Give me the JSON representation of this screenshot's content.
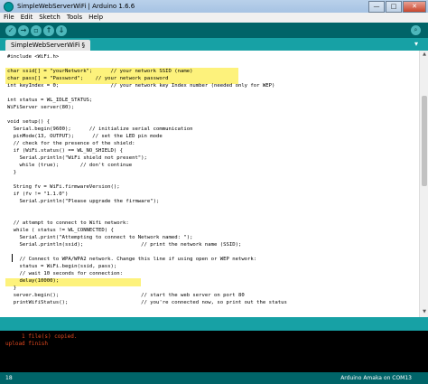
{
  "window": {
    "title": "SimpleWebServerWiFi | Arduino 1.6.6"
  },
  "menu": [
    "File",
    "Edit",
    "Sketch",
    "Tools",
    "Help"
  ],
  "toolbar": {
    "verify_icon": "check-icon",
    "upload_icon": "arrow-right-icon",
    "new_icon": "new-file-icon",
    "open_icon": "arrow-up-icon",
    "save_icon": "arrow-down-icon",
    "serial_icon": "magnifier-icon"
  },
  "tab": {
    "label": "SimpleWebServerWiFi §"
  },
  "code": [
    "#include <WiFi.h>",
    "",
    "char ssid[] = \"yourNetwork\";      // your network SSID (name)",
    "char pass[] = \"Password\";    // your network password",
    "int keyIndex = 0;                 // your network key Index number (needed only for WEP)",
    "",
    "int status = WL_IDLE_STATUS;",
    "WiFiServer server(80);",
    "",
    "void setup() {",
    "  Serial.begin(9600);      // initialize serial communication",
    "  pinMode(13, OUTPUT);      // set the LED pin mode",
    "  // check for the presence of the shield:",
    "  if (WiFi.status() == WL_NO_SHIELD) {",
    "    Serial.println(\"WiFi shield not present\");",
    "    while (true);       // don't continue",
    "  }",
    "",
    "  String fv = WiFi.firmwareVersion();",
    "  if (fv != \"1.1.0\")",
    "    Serial.println(\"Please upgrade the firmware\");",
    "",
    "",
    "  // attempt to connect to Wifi network:",
    "  while ( status != WL_CONNECTED) {",
    "    Serial.print(\"Attempting to connect to Network named: \");",
    "    Serial.println(ssid);                   // print the network name (SSID);",
    "",
    "    // Connect to WPA/WPA2 network. Change this line if using open or WEP network:",
    "    status = WiFi.begin(ssid, pass);",
    "    // wait 10 seconds for connection:",
    "    delay(10000);",
    "  }",
    "  server.begin();                           // start the web server on port 80",
    "  printWifiStatus();                        // you're connected now, so print out the status"
  ],
  "console": [
    "     1 file(s) copied.",
    "upload finish"
  ],
  "status": {
    "line": "18",
    "board": "Arduino Amaka on COM13"
  }
}
